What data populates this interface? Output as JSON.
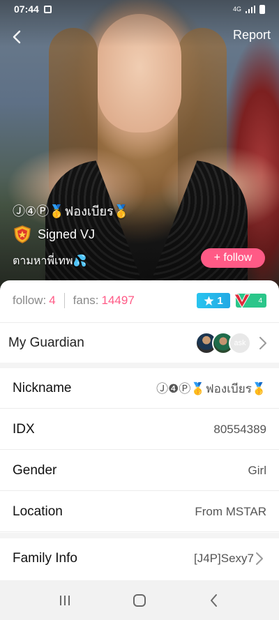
{
  "status_bar": {
    "time": "07:44",
    "network": "4G"
  },
  "header": {
    "report_label": "Report"
  },
  "profile": {
    "name": "Ⓙ④Ⓟ🥇ฟองเบียร🥇",
    "signed_label": "Signed VJ",
    "bio": "ตามหาพี่เทพ💦",
    "follow_button": "+ follow"
  },
  "stats": {
    "follow_label": "follow:",
    "follow_value": "4",
    "fans_label": "fans:",
    "fans_value": "14497",
    "star_level": "1",
    "vip_level": "4"
  },
  "guardian": {
    "label": "My Guardian",
    "avatar_text": "ask"
  },
  "info": {
    "nickname_label": "Nickname",
    "nickname_value": "Ⓙ❹Ⓟ🥇ฟองเบียร🥇",
    "idx_label": "IDX",
    "idx_value": "80554389",
    "gender_label": "Gender",
    "gender_value": "Girl",
    "location_label": "Location",
    "location_value": "From MSTAR",
    "family_label": "Family Info",
    "family_value": "[J4P]Sexy7"
  },
  "colors": {
    "accent_pink": "#ff5a86",
    "star_blue": "#29c4ef",
    "vip_green": "#2bc68a",
    "vip_red": "#e02b3c"
  }
}
